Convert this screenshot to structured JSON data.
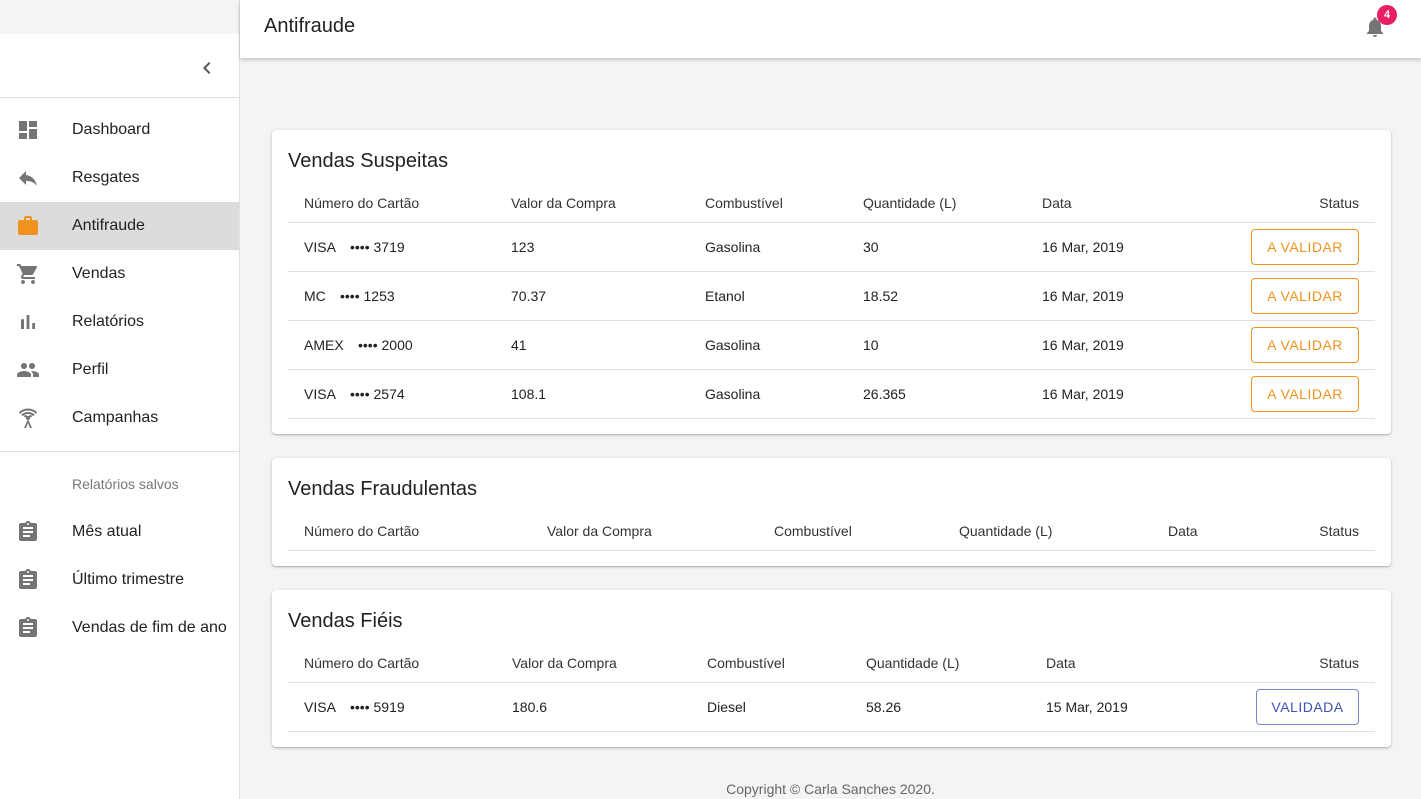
{
  "app": {
    "title": "Antifraude",
    "notifications_count": "4"
  },
  "sidebar": {
    "nav": [
      {
        "label": "Dashboard",
        "icon": "dashboard-icon"
      },
      {
        "label": "Resgates",
        "icon": "reply-icon"
      },
      {
        "label": "Antifraude",
        "icon": "briefcase-icon",
        "active": true
      },
      {
        "label": "Vendas",
        "icon": "cart-icon"
      },
      {
        "label": "Relatórios",
        "icon": "bar-chart-icon"
      },
      {
        "label": "Perfil",
        "icon": "people-icon"
      },
      {
        "label": "Campanhas",
        "icon": "broadcast-icon"
      }
    ],
    "saved_header": "Relatórios salvos",
    "saved": [
      {
        "label": "Mês atual",
        "icon": "clipboard-icon"
      },
      {
        "label": "Último trimestre",
        "icon": "clipboard-icon"
      },
      {
        "label": "Vendas de fim de ano",
        "icon": "clipboard-icon"
      }
    ]
  },
  "columns": {
    "card": "Número do Cartão",
    "value": "Valor da Compra",
    "fuel": "Combustível",
    "qty": "Quantidade (L)",
    "date": "Data",
    "status": "Status"
  },
  "suspicious": {
    "title": "Vendas Suspeitas",
    "rows": [
      {
        "brand": "VISA",
        "last4": "•••• 3719",
        "value": "123",
        "fuel": "Gasolina",
        "qty": "30",
        "date": "16 Mar, 2019",
        "status": "A VALIDAR"
      },
      {
        "brand": "MC",
        "last4": "•••• 1253",
        "value": "70.37",
        "fuel": "Etanol",
        "qty": "18.52",
        "date": "16 Mar, 2019",
        "status": "A VALIDAR"
      },
      {
        "brand": "AMEX",
        "last4": "•••• 2000",
        "value": "41",
        "fuel": "Gasolina",
        "qty": "10",
        "date": "16 Mar, 2019",
        "status": "A VALIDAR"
      },
      {
        "brand": "VISA",
        "last4": "•••• 2574",
        "value": "108.1",
        "fuel": "Gasolina",
        "qty": "26.365",
        "date": "16 Mar, 2019",
        "status": "A VALIDAR"
      }
    ]
  },
  "fraudulent": {
    "title": "Vendas Fraudulentas",
    "rows": []
  },
  "loyal": {
    "title": "Vendas Fiéis",
    "rows": [
      {
        "brand": "VISA",
        "last4": "•••• 5919",
        "value": "180.6",
        "fuel": "Diesel",
        "qty": "58.26",
        "date": "15 Mar, 2019",
        "status": "VALIDADA"
      }
    ]
  },
  "footer": "Copyright © Carla Sanches 2020.",
  "colors": {
    "accent_orange": "#f0921e",
    "badge_pink": "#e91e63",
    "validated_blue": "#3f51b5"
  }
}
